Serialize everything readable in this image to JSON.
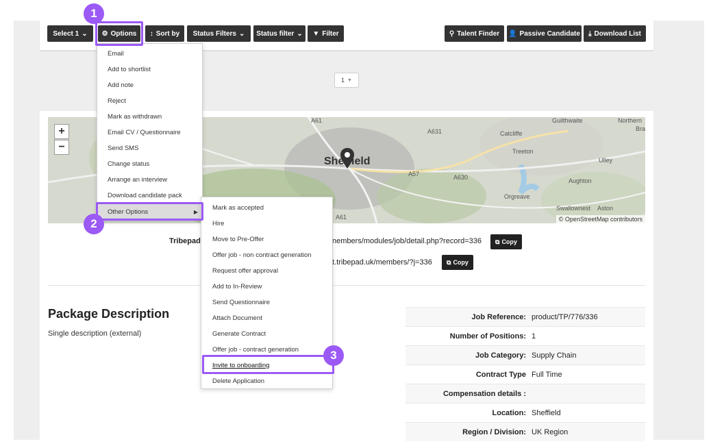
{
  "toolbar": {
    "select_label": "Select 1",
    "options_label": "Options",
    "sort_label": "Sort by",
    "status_filters_label": "Status Filters",
    "status_filter_label": "Status filter",
    "filter_label": "Filter",
    "talent_finder_label": "Talent Finder",
    "passive_candidate_label": "Passive Candidate",
    "download_list_label": "Download List"
  },
  "pager": {
    "value": "1"
  },
  "options_menu": {
    "items": [
      "Email",
      "Add to shortlist",
      "Add note",
      "Reject",
      "Mark as withdrawn",
      "Email CV / Questionnaire",
      "Send SMS",
      "Change status",
      "Arrange an interview",
      "Download candidate pack",
      "Other Options"
    ]
  },
  "other_options_menu": {
    "items": [
      "Mark as accepted",
      "Hire",
      "Move to Pre-Offer",
      "Offer job - non contract generation",
      "Request offer approval",
      "Add to In-Review",
      "Send Questionnaire",
      "Attach Document",
      "Generate Contract",
      "Offer job - contract generation",
      "Invite to onboarding",
      "Delete Application"
    ]
  },
  "map": {
    "zoom_in": "+",
    "zoom_out": "−",
    "attribution": "© OpenStreetMap contributors",
    "labels": {
      "city": "Sheffield",
      "a61_top": "A61",
      "a631": "A631",
      "a57": "A57",
      "a630": "A630",
      "a61_bottom": "A61",
      "catcliffe": "Catcliffe",
      "treeton": "Treeton",
      "ulley": "Ulley",
      "aughton": "Aughton",
      "orgreave": "Orgreave",
      "swallownest": "Swallownest",
      "aston": "Aston",
      "guilthwaite": "Guilthwaite",
      "northern": "Northern",
      "bra": "Bra"
    }
  },
  "links": {
    "tribepad_label": "Tribepad",
    "link1": "nembers/modules/job/detail.php?record=336",
    "link2": "t.tribepad.uk/members/?j=336",
    "copy_label": "Copy"
  },
  "package": {
    "title": "Package Description",
    "description": "Single description (external)"
  },
  "details": [
    {
      "key": "Job Reference:",
      "value": "product/TP/776/336"
    },
    {
      "key": "Number of Positions:",
      "value": "1"
    },
    {
      "key": "Job Category:",
      "value": "Supply Chain"
    },
    {
      "key": "Contract Type",
      "value": "Full Time"
    },
    {
      "key": "Compensation details :",
      "value": ""
    },
    {
      "key": "Location:",
      "value": "Sheffield"
    },
    {
      "key": "Region / Division:",
      "value": "UK Region"
    }
  ],
  "callouts": {
    "one": "1",
    "two": "2",
    "three": "3"
  },
  "colors": {
    "accent": "#9b59f5",
    "button_dark": "#333333"
  }
}
